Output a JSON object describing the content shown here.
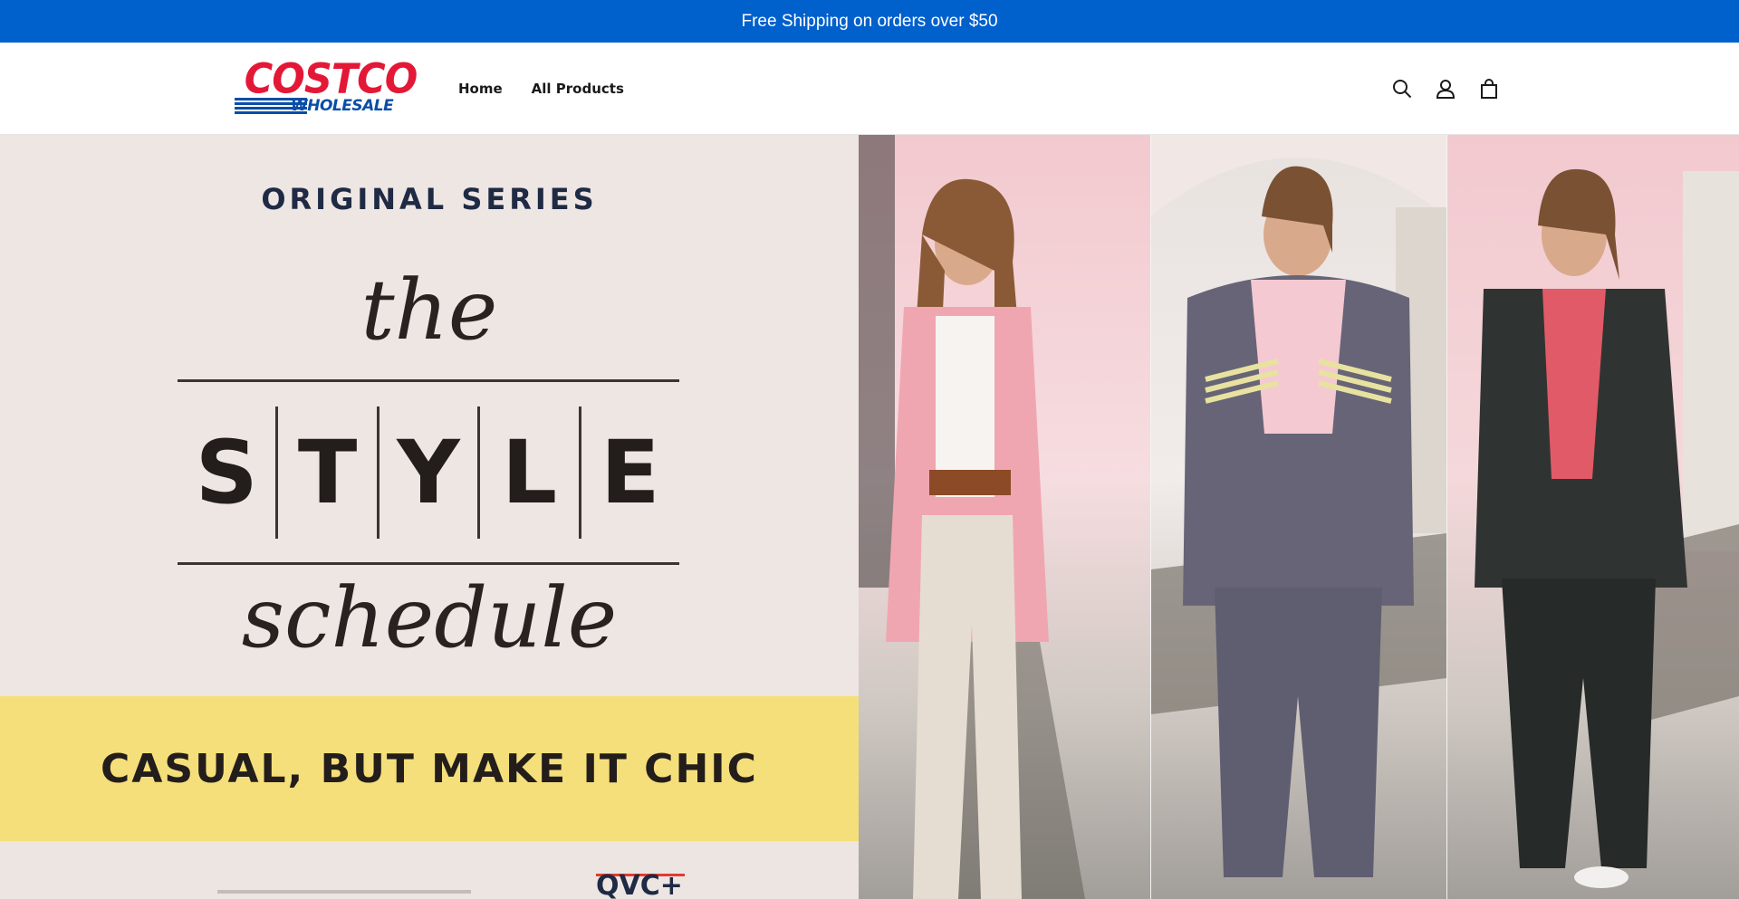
{
  "announcement": {
    "text": "Free Shipping on orders over $50"
  },
  "header": {
    "logo": {
      "word": "COSTCO",
      "sub": "WHOLESALE"
    },
    "nav": [
      {
        "label": "Home"
      },
      {
        "label": "All Products"
      }
    ],
    "icons": [
      "search-icon",
      "account-icon",
      "cart-icon"
    ]
  },
  "hero": {
    "series_label": "ORIGINAL SERIES",
    "the_word": "the",
    "style_letters": [
      "S",
      "T",
      "Y",
      "L",
      "E"
    ],
    "schedule_word": "schedule",
    "tagline": "CASUAL, BUT MAKE IT CHIC",
    "network_mark": "QVC+"
  },
  "colors": {
    "announcement_bg": "#0060cc",
    "brand_red": "#e31837",
    "brand_blue": "#0a4ea8",
    "band_yellow": "#f5df7a",
    "hero_left_bg": "#ede6e3"
  }
}
